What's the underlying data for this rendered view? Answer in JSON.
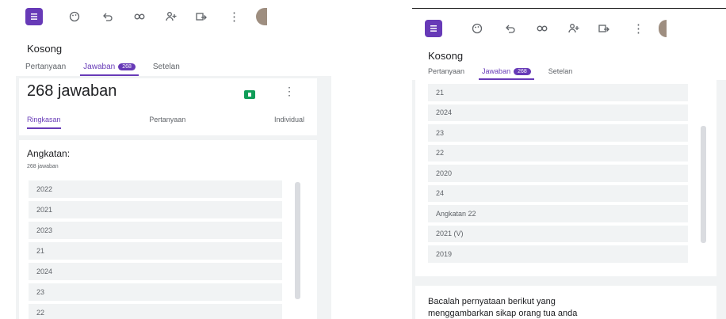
{
  "left": {
    "form_title": "Kosong",
    "tabs": [
      {
        "label": "Pertanyaan",
        "active": false
      },
      {
        "label": "Jawaban",
        "badge": "268",
        "active": true
      },
      {
        "label": "Setelan",
        "active": false
      }
    ],
    "response_count": "268 jawaban",
    "subtabs": [
      {
        "label": "Ringkasan",
        "active": true
      },
      {
        "label": "Pertanyaan",
        "active": false
      },
      {
        "label": "Individual",
        "active": false
      }
    ],
    "question": {
      "title": "Angkatan:",
      "subtitle": "268 jawaban",
      "answers": [
        "2022",
        "2021",
        "2023",
        "21",
        "2024",
        "23",
        "22"
      ]
    }
  },
  "right": {
    "form_title": "Kosong",
    "tabs": [
      {
        "label": "Pertanyaan",
        "active": false
      },
      {
        "label": "Jawaban",
        "badge": "268",
        "active": true
      },
      {
        "label": "Setelan",
        "active": false
      }
    ],
    "answers": [
      "21",
      "2024",
      "23",
      "22",
      "2020",
      "24",
      "Angkatan 22",
      "2021 (V)",
      "2019"
    ],
    "next_question": {
      "line1": "Bacalah pernyataan berikut yang",
      "line2": "menggambarkan sikap orang tua anda"
    }
  },
  "icons": [
    "form-icon",
    "palette-icon",
    "undo-icon",
    "link-icon",
    "add-collaborator-icon",
    "send-icon",
    "more-vert-icon"
  ],
  "colors": {
    "accent": "#673ab7",
    "sheets": "#0f9d58",
    "background": "#f1f3f4"
  }
}
